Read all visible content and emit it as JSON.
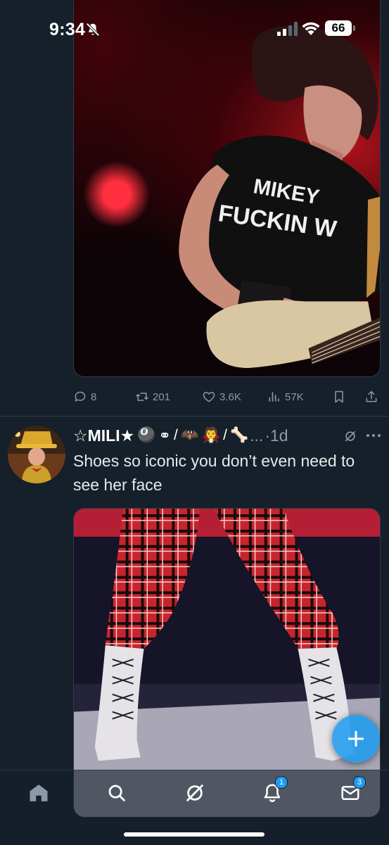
{
  "status_bar": {
    "time": "9:34",
    "battery": "66",
    "icons": [
      "bell-slash-icon",
      "signal-icon",
      "wifi-icon",
      "battery-icon"
    ]
  },
  "post1": {
    "media_caption_text": "MIKEY FUCKIN W",
    "actions": {
      "replies": "8",
      "reposts": "201",
      "likes": "3.6K",
      "views": "57K"
    },
    "action_icons": [
      "reply-icon",
      "repost-icon",
      "like-icon",
      "views-icon",
      "bookmark-icon",
      "share-icon"
    ]
  },
  "post2": {
    "display_name": "☆MILI★",
    "name_emojis": [
      "🎱",
      "⚭",
      "/",
      "🦇",
      "🧛",
      "/",
      "🦴"
    ],
    "ellipsis": "...",
    "time": "·1d",
    "text": "Shoes so iconic you don’t even need to see her face"
  },
  "fab": {
    "icon": "plus-icon"
  },
  "bottom_nav": {
    "items": [
      {
        "name": "home",
        "icon": "home-icon"
      },
      {
        "name": "search",
        "icon": "search-icon"
      },
      {
        "name": "grok",
        "icon": "grok-icon"
      },
      {
        "name": "notifications",
        "icon": "bell-icon",
        "badge": "1"
      },
      {
        "name": "messages",
        "icon": "mail-icon",
        "badge": "3"
      }
    ]
  },
  "colors": {
    "background": "#15202b",
    "text": "#e7e9ea",
    "secondary_text": "#8b98a5",
    "accent": "#1d9bf0",
    "divider": "#2f3b47"
  }
}
